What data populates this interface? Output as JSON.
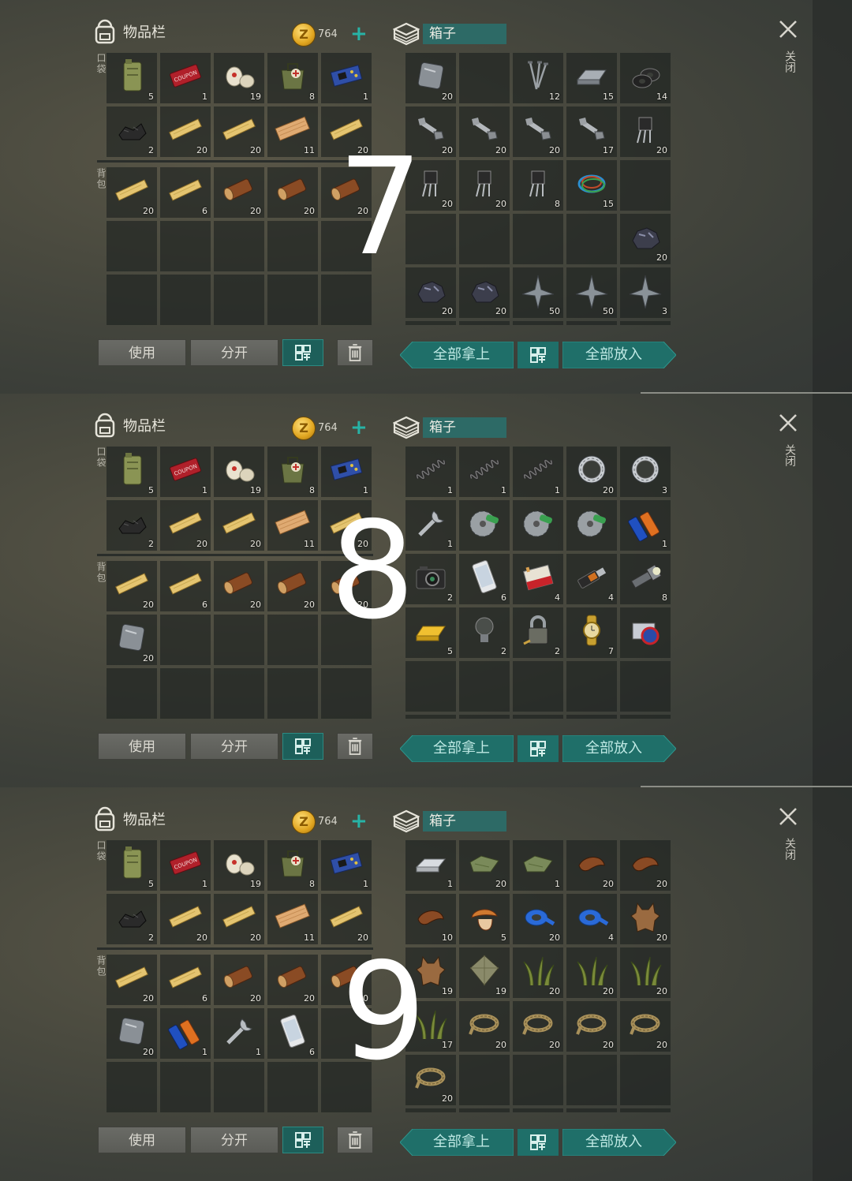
{
  "common": {
    "inventory_title": "物品栏",
    "coin_symbol": "Z",
    "coins": "764",
    "coin_add": "+",
    "pocket_label": "口袋",
    "backpack_label": "背包",
    "use_button": "使用",
    "split_button": "分开",
    "box_title": "箱子",
    "take_all_button": "全部拿上",
    "put_all_button": "全部放入",
    "close_label": "关闭"
  },
  "panels": [
    {
      "step": "7",
      "pocket": [
        {
          "icon": "jerrycan-icon",
          "count": "5"
        },
        {
          "icon": "coupon-icon",
          "count": "1"
        },
        {
          "icon": "bandage-icon",
          "count": "19"
        },
        {
          "icon": "medkit-bag-icon",
          "count": "8"
        },
        {
          "icon": "circuit-board-icon",
          "count": "1"
        },
        {
          "icon": "coal-icon",
          "count": "2"
        },
        {
          "icon": "plank-icon",
          "count": "20"
        },
        {
          "icon": "plank-icon",
          "count": "20"
        },
        {
          "icon": "board-icon",
          "count": "11"
        },
        {
          "icon": "plank-icon",
          "count": "20"
        }
      ],
      "backpack": [
        {
          "icon": "plank-icon",
          "count": "20"
        },
        {
          "icon": "plank-icon",
          "count": "6"
        },
        {
          "icon": "log-icon",
          "count": "20"
        },
        {
          "icon": "log-icon",
          "count": "20"
        },
        {
          "icon": "log-icon",
          "count": "20"
        },
        {
          "icon": "",
          "count": ""
        },
        {
          "icon": "",
          "count": ""
        },
        {
          "icon": "",
          "count": ""
        },
        {
          "icon": "",
          "count": ""
        },
        {
          "icon": "",
          "count": ""
        },
        {
          "icon": "",
          "count": ""
        },
        {
          "icon": "",
          "count": ""
        },
        {
          "icon": "",
          "count": ""
        },
        {
          "icon": "",
          "count": ""
        },
        {
          "icon": "",
          "count": ""
        }
      ],
      "box": [
        {
          "icon": "metal-plate-icon",
          "count": "20"
        },
        {
          "icon": "",
          "count": ""
        },
        {
          "icon": "nails-icon",
          "count": "12"
        },
        {
          "icon": "ingot-icon",
          "count": "15"
        },
        {
          "icon": "washers-icon",
          "count": "14"
        },
        {
          "icon": "bolt-nut-icon",
          "count": "20"
        },
        {
          "icon": "bolt-nut-icon",
          "count": "20"
        },
        {
          "icon": "bolt-nut-icon",
          "count": "20"
        },
        {
          "icon": "bolt-nut-icon",
          "count": "17"
        },
        {
          "icon": "transistor-icon",
          "count": "20"
        },
        {
          "icon": "transistor-icon",
          "count": "20"
        },
        {
          "icon": "transistor-icon",
          "count": "20"
        },
        {
          "icon": "transistor-icon",
          "count": "8"
        },
        {
          "icon": "wire-icon",
          "count": "15"
        },
        {
          "icon": "",
          "count": ""
        },
        {
          "icon": "",
          "count": ""
        },
        {
          "icon": "",
          "count": ""
        },
        {
          "icon": "",
          "count": ""
        },
        {
          "icon": "",
          "count": ""
        },
        {
          "icon": "ore-icon",
          "count": "20"
        },
        {
          "icon": "ore-icon",
          "count": "20"
        },
        {
          "icon": "ore-icon",
          "count": "20"
        },
        {
          "icon": "spikes-icon",
          "count": "50"
        },
        {
          "icon": "spikes-icon",
          "count": "50"
        },
        {
          "icon": "spikes-icon",
          "count": "3"
        }
      ]
    },
    {
      "step": "8",
      "pocket": [
        {
          "icon": "jerrycan-icon",
          "count": "5"
        },
        {
          "icon": "coupon-icon",
          "count": "1"
        },
        {
          "icon": "bandage-icon",
          "count": "19"
        },
        {
          "icon": "medkit-bag-icon",
          "count": "8"
        },
        {
          "icon": "circuit-board-icon",
          "count": "1"
        },
        {
          "icon": "coal-icon",
          "count": "2"
        },
        {
          "icon": "plank-icon",
          "count": "20"
        },
        {
          "icon": "plank-icon",
          "count": "20"
        },
        {
          "icon": "board-icon",
          "count": "11"
        },
        {
          "icon": "plank-icon",
          "count": "20"
        }
      ],
      "backpack": [
        {
          "icon": "plank-icon",
          "count": "20"
        },
        {
          "icon": "plank-icon",
          "count": "6"
        },
        {
          "icon": "log-icon",
          "count": "20"
        },
        {
          "icon": "log-icon",
          "count": "20"
        },
        {
          "icon": "log-icon",
          "count": "20"
        },
        {
          "icon": "metal-plate-icon",
          "count": "20"
        },
        {
          "icon": "",
          "count": ""
        },
        {
          "icon": "",
          "count": ""
        },
        {
          "icon": "",
          "count": ""
        },
        {
          "icon": "",
          "count": ""
        },
        {
          "icon": "",
          "count": ""
        },
        {
          "icon": "",
          "count": ""
        },
        {
          "icon": "",
          "count": ""
        },
        {
          "icon": "",
          "count": ""
        },
        {
          "icon": "",
          "count": ""
        }
      ],
      "box": [
        {
          "icon": "spring-icon",
          "count": "1"
        },
        {
          "icon": "spring-icon",
          "count": "1"
        },
        {
          "icon": "spring-icon",
          "count": "1"
        },
        {
          "icon": "bearing-icon",
          "count": "20"
        },
        {
          "icon": "bearing-icon",
          "count": "3"
        },
        {
          "icon": "wrench-icon",
          "count": "1"
        },
        {
          "icon": "saw-blade-icon",
          "count": ""
        },
        {
          "icon": "saw-blade-icon",
          "count": ""
        },
        {
          "icon": "saw-blade-icon",
          "count": ""
        },
        {
          "icon": "battery-icon",
          "count": "1"
        },
        {
          "icon": "camera-icon",
          "count": "2"
        },
        {
          "icon": "phone-icon",
          "count": "6"
        },
        {
          "icon": "cigarettes-icon",
          "count": "4"
        },
        {
          "icon": "usb-drive-icon",
          "count": "4"
        },
        {
          "icon": "flashlight-icon",
          "count": "8"
        },
        {
          "icon": "gold-bar-icon",
          "count": "5"
        },
        {
          "icon": "light-bulb-icon",
          "count": "2"
        },
        {
          "icon": "padlock-icon",
          "count": "2"
        },
        {
          "icon": "watch-icon",
          "count": "7"
        },
        {
          "icon": "patch-icon",
          "count": ""
        },
        {
          "icon": "",
          "count": ""
        },
        {
          "icon": "",
          "count": ""
        },
        {
          "icon": "",
          "count": ""
        },
        {
          "icon": "",
          "count": ""
        },
        {
          "icon": "",
          "count": ""
        }
      ]
    },
    {
      "step": "9",
      "pocket": [
        {
          "icon": "jerrycan-icon",
          "count": "5"
        },
        {
          "icon": "coupon-icon",
          "count": "1"
        },
        {
          "icon": "bandage-icon",
          "count": "19"
        },
        {
          "icon": "medkit-bag-icon",
          "count": "8"
        },
        {
          "icon": "circuit-board-icon",
          "count": "1"
        },
        {
          "icon": "coal-icon",
          "count": "2"
        },
        {
          "icon": "plank-icon",
          "count": "20"
        },
        {
          "icon": "plank-icon",
          "count": "20"
        },
        {
          "icon": "board-icon",
          "count": "11"
        },
        {
          "icon": "plank-icon",
          "count": "20"
        }
      ],
      "backpack": [
        {
          "icon": "plank-icon",
          "count": "20"
        },
        {
          "icon": "plank-icon",
          "count": "6"
        },
        {
          "icon": "log-icon",
          "count": "20"
        },
        {
          "icon": "log-icon",
          "count": "20"
        },
        {
          "icon": "log-icon",
          "count": "20"
        },
        {
          "icon": "metal-plate-icon",
          "count": "20"
        },
        {
          "icon": "battery-icon",
          "count": "1"
        },
        {
          "icon": "wrench-icon",
          "count": "1"
        },
        {
          "icon": "phone-icon",
          "count": "6"
        },
        {
          "icon": "",
          "count": ""
        },
        {
          "icon": "",
          "count": ""
        },
        {
          "icon": "",
          "count": ""
        },
        {
          "icon": "",
          "count": ""
        },
        {
          "icon": "",
          "count": ""
        },
        {
          "icon": "",
          "count": ""
        }
      ],
      "box": [
        {
          "icon": "silver-ingot-icon",
          "count": "1"
        },
        {
          "icon": "cloth-icon",
          "count": "20"
        },
        {
          "icon": "cloth-icon",
          "count": "1"
        },
        {
          "icon": "leather-icon",
          "count": "20"
        },
        {
          "icon": "leather-icon",
          "count": "20"
        },
        {
          "icon": "leather-icon",
          "count": "10"
        },
        {
          "icon": "mushroom-icon",
          "count": "5"
        },
        {
          "icon": "tape-icon",
          "count": "20"
        },
        {
          "icon": "tape-icon",
          "count": "4"
        },
        {
          "icon": "hide-icon",
          "count": "20"
        },
        {
          "icon": "hide-icon",
          "count": "19"
        },
        {
          "icon": "fabric-icon",
          "count": "19"
        },
        {
          "icon": "grass-icon",
          "count": "20"
        },
        {
          "icon": "grass-icon",
          "count": "20"
        },
        {
          "icon": "grass-icon",
          "count": "20"
        },
        {
          "icon": "grass-icon",
          "count": "17"
        },
        {
          "icon": "rope-icon",
          "count": "20"
        },
        {
          "icon": "rope-icon",
          "count": "20"
        },
        {
          "icon": "rope-icon",
          "count": "20"
        },
        {
          "icon": "rope-icon",
          "count": "20"
        },
        {
          "icon": "rope-icon",
          "count": "20"
        },
        {
          "icon": "",
          "count": ""
        },
        {
          "icon": "",
          "count": ""
        },
        {
          "icon": "",
          "count": ""
        },
        {
          "icon": "",
          "count": ""
        }
      ]
    }
  ]
}
